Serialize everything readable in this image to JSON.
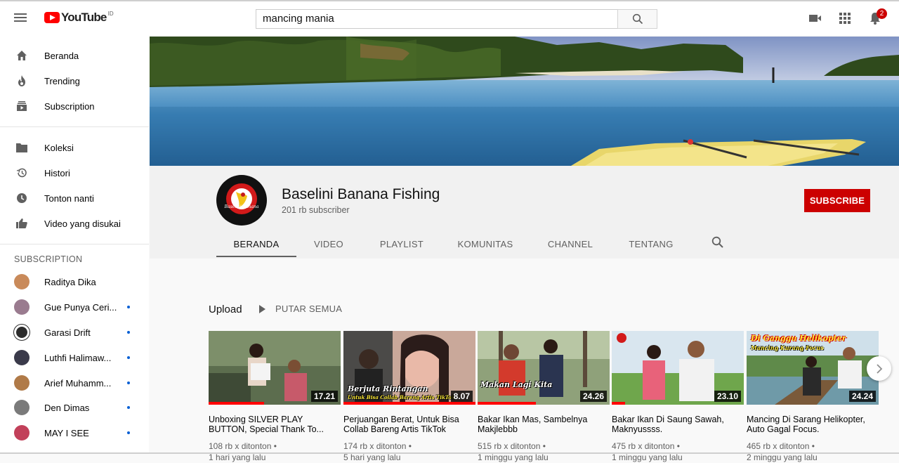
{
  "header": {
    "logo_text": "YouTube",
    "country_code": "ID",
    "search_value": "mancing mania",
    "notification_count": "2"
  },
  "sidebar": {
    "main": [
      {
        "label": "Beranda",
        "icon": "home-icon"
      },
      {
        "label": "Trending",
        "icon": "flame-icon"
      },
      {
        "label": "Subscription",
        "icon": "subscriptions-icon"
      }
    ],
    "library": [
      {
        "label": "Koleksi",
        "icon": "folder-icon"
      },
      {
        "label": "Histori",
        "icon": "history-icon"
      },
      {
        "label": "Tonton nanti",
        "icon": "clock-icon"
      },
      {
        "label": "Video yang disukai",
        "icon": "thumbs-up-icon"
      }
    ],
    "subscription_heading": "SUBSCRIPTION",
    "subscriptions": [
      {
        "name": "Raditya Dika",
        "color": "#c98a5a",
        "new": false
      },
      {
        "name": "Gue Punya Ceri...",
        "color": "#9a7b8f",
        "new": true
      },
      {
        "name": "Garasi Drift",
        "color": "#2b2b2b",
        "new": true
      },
      {
        "name": "Luthfi Halimaw...",
        "color": "#3a3a4a",
        "new": true
      },
      {
        "name": "Arief Muhamm...",
        "color": "#b07a48",
        "new": true
      },
      {
        "name": "Den Dimas",
        "color": "#7a7a7a",
        "new": true
      },
      {
        "name": "MAY I SEE",
        "color": "#c2405a",
        "new": true
      }
    ]
  },
  "channel": {
    "name": "Baselini Banana Fishing",
    "subscribers": "201 rb subscriber",
    "subscribe_label": "SUBSCRIBE",
    "avatar_text": "Baselini Banana",
    "tabs": [
      "BERANDA",
      "VIDEO",
      "PLAYLIST",
      "KOMUNITAS",
      "CHANNEL",
      "TENTANG"
    ]
  },
  "section": {
    "title": "Upload",
    "play_all": "PUTAR SEMUA"
  },
  "videos": [
    {
      "title": "Unboxing SILVER PLAY BUTTON, Special Thank To...",
      "duration": "17.21",
      "views": "108 rb x ditonton •",
      "age": "1 hari yang lalu",
      "watched": 0.42,
      "overlay": ""
    },
    {
      "title": "Perjuangan Berat, Untuk Bisa Collab Bareng Artis TikTok",
      "duration": "8.07",
      "views": "174 rb x ditonton •",
      "age": "5 hari yang lalu",
      "watched": 1.0,
      "overlay": "Berjuta Rintangan",
      "overlay2": "Untuk Bisa Collab Bareng Artis TikTok"
    },
    {
      "title": "Bakar Ikan Mas, Sambelnya Makjlebbb",
      "duration": "24.26",
      "views": "515 rb x ditonton •",
      "age": "1 minggu yang lalu",
      "watched": 0.44,
      "overlay": "Makan Lagi Kita"
    },
    {
      "title": "Bakar Ikan Di Saung Sawah, Maknyussss.",
      "duration": "23.10",
      "views": "475 rb x ditonton •",
      "age": "1 minggu yang lalu",
      "watched": 0.1,
      "overlay": ""
    },
    {
      "title": "Mancing Di Sarang Helikopter, Auto Gagal Focus.",
      "duration": "24.24",
      "views": "465 rb x ditonton •",
      "age": "2 minggu yang lalu",
      "watched": 0.0,
      "overlay": "Di Ganggu Helikopter",
      "overlay2": "Mancing Kurang Focus"
    }
  ]
}
